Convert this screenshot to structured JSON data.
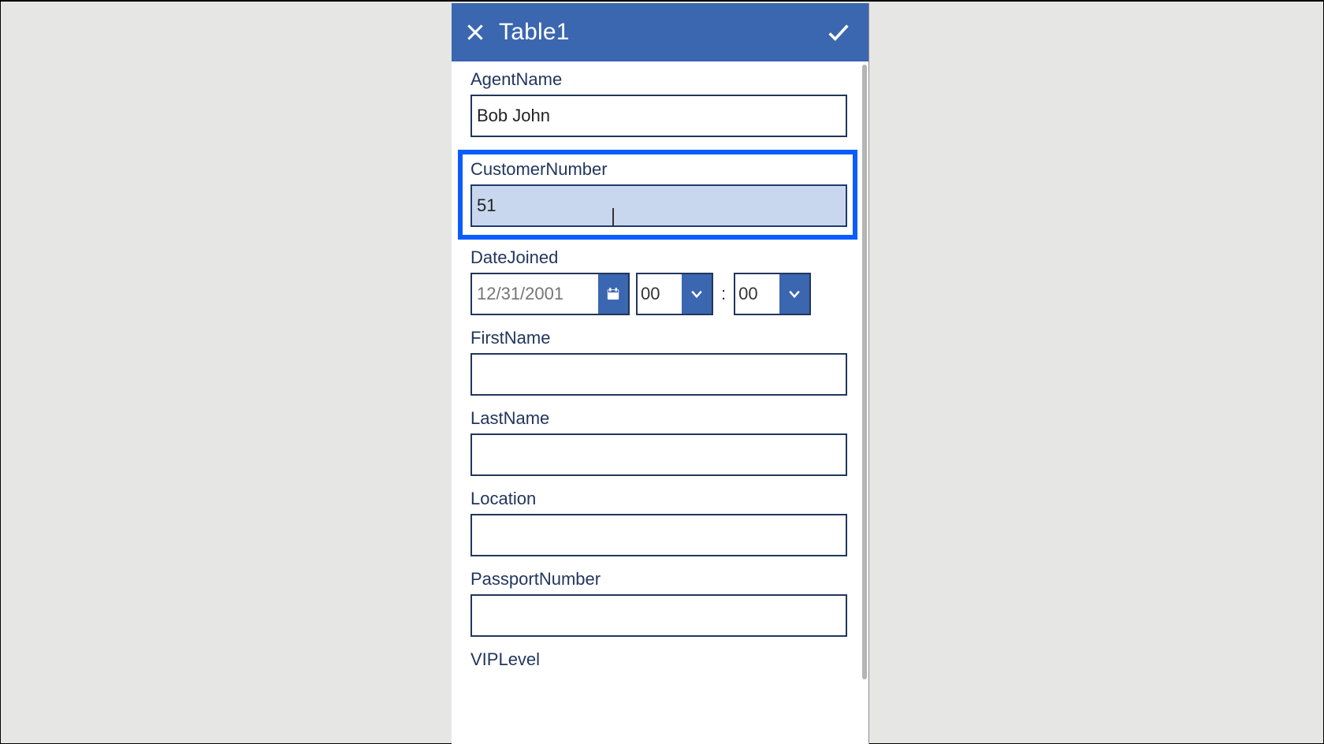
{
  "header": {
    "title": "Table1"
  },
  "fields": {
    "agentName": {
      "label": "AgentName",
      "value": "Bob John"
    },
    "customerNumber": {
      "label": "CustomerNumber",
      "value": "51"
    },
    "dateJoined": {
      "label": "DateJoined",
      "date_placeholder": "12/31/2001",
      "hour": "00",
      "minute": "00",
      "separator": ":"
    },
    "firstName": {
      "label": "FirstName",
      "value": ""
    },
    "lastName": {
      "label": "LastName",
      "value": ""
    },
    "location": {
      "label": "Location",
      "value": ""
    },
    "passportNumber": {
      "label": "PassportNumber",
      "value": ""
    },
    "vipLevel": {
      "label": "VIPLevel"
    }
  },
  "icons": {
    "close": "close-icon",
    "submit": "check-icon",
    "calendar": "calendar-icon",
    "chevron": "chevron-down-icon"
  },
  "colors": {
    "header": "#3b66b0",
    "label": "#22365d",
    "active_border": "#0a5cff",
    "active_fill": "#c9d7ee"
  }
}
